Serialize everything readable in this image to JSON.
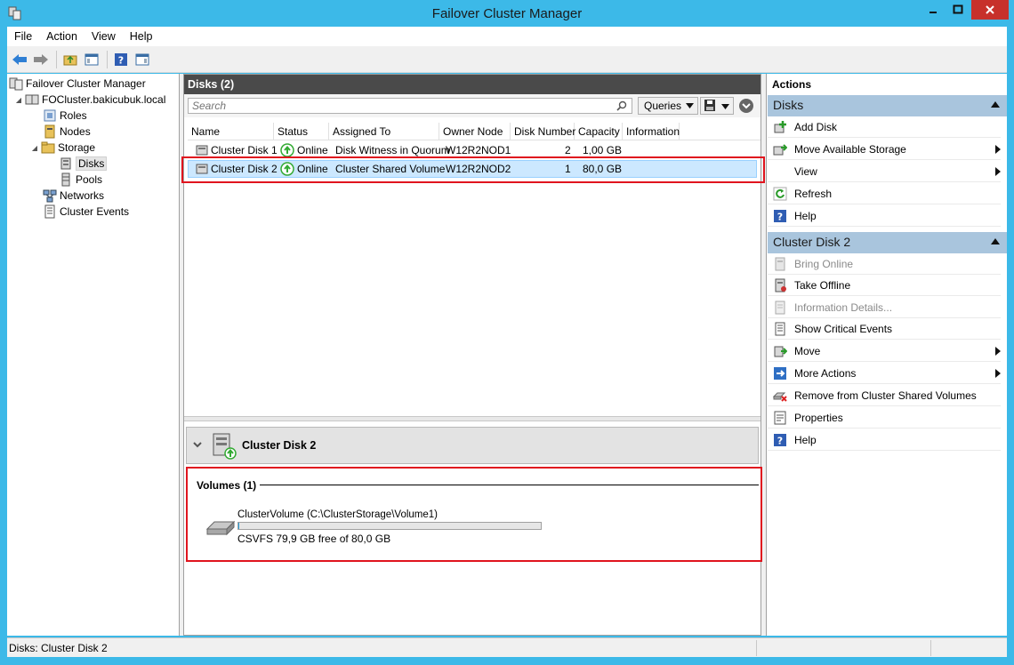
{
  "window": {
    "title": "Failover Cluster Manager"
  },
  "menu": [
    "File",
    "Action",
    "View",
    "Help"
  ],
  "tree": {
    "root": "Failover Cluster Manager",
    "cluster": "FOCluster.bakicubuk.local",
    "roles": "Roles",
    "nodes": "Nodes",
    "storage": "Storage",
    "disks": "Disks",
    "pools": "Pools",
    "networks": "Networks",
    "events": "Cluster Events"
  },
  "center": {
    "title": "Disks (2)",
    "search_placeholder": "Search",
    "queries_label": "Queries",
    "columns": [
      "Name",
      "Status",
      "Assigned To",
      "Owner Node",
      "Disk Number",
      "Capacity",
      "Information"
    ],
    "rows": [
      {
        "name": "Cluster Disk 1",
        "status": "Online",
        "assigned": "Disk Witness in Quorum",
        "owner": "W12R2NOD1",
        "disknum": "2",
        "capacity": "1,00 GB",
        "info": ""
      },
      {
        "name": "Cluster Disk 2",
        "status": "Online",
        "assigned": "Cluster Shared Volume",
        "owner": "W12R2NOD2",
        "disknum": "1",
        "capacity": "80,0 GB",
        "info": ""
      }
    ]
  },
  "detail": {
    "title": "Cluster Disk 2",
    "volumes_title": "Volumes (1)",
    "volume_name": "ClusterVolume (C:\\ClusterStorage\\Volume1)",
    "volume_used_fraction": 0.0013,
    "volume_info": "CSVFS 79,9 GB free of 80,0 GB"
  },
  "actions": {
    "title": "Actions",
    "section1": "Disks",
    "section1_items": [
      "Add Disk",
      "Move Available Storage",
      "View",
      "Refresh",
      "Help"
    ],
    "section2": "Cluster Disk 2",
    "section2_items": [
      "Bring Online",
      "Take Offline",
      "Information Details...",
      "Show Critical Events",
      "Move",
      "More Actions",
      "Remove from Cluster Shared Volumes",
      "Properties",
      "Help"
    ]
  },
  "statusbar": {
    "text": "Disks:  Cluster Disk 2"
  },
  "colors": {
    "accent": "#3cb9e8",
    "selection": "#cce8ff",
    "highlight_frame": "#e0141e",
    "action_section": "#a9c5dd"
  }
}
